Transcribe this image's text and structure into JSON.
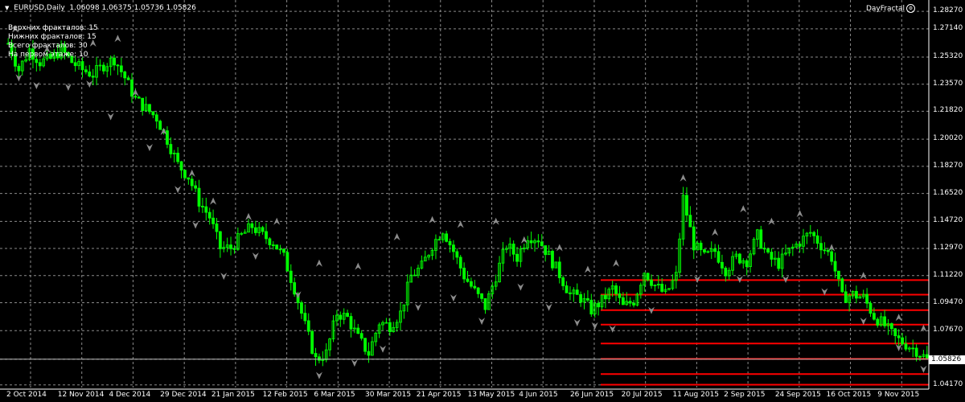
{
  "header": {
    "symbol": "EURUSD,Daily",
    "ohlc": "1.06098 1.06375 1.05736 1.05826",
    "indicator": "DayFractal"
  },
  "stats": [
    "Верхних фракталов: 15",
    "Нижних фракталов: 15",
    "Всего фракталов: 30",
    "На первом этаже: 10"
  ],
  "chart_data": {
    "type": "candlestick",
    "symbol": "EURUSD",
    "timeframe": "Daily",
    "current_price": "1.05826",
    "ylim": [
      1.04,
      1.29
    ],
    "y_ticks": [
      "1.28270",
      "1.27140",
      "1.25320",
      "1.23570",
      "1.21820",
      "1.20020",
      "1.18270",
      "1.16520",
      "1.14720",
      "1.12970",
      "1.11220",
      "1.09470",
      "1.07670",
      "1.05826",
      "1.04170"
    ],
    "x_ticks": [
      "2 Oct 2014",
      "12 Nov 2014",
      "4 Dec 2014",
      "29 Dec 2014",
      "21 Jan 2015",
      "12 Feb 2015",
      "6 Mar 2015",
      "30 Mar 2015",
      "21 Apr 2015",
      "13 May 2015",
      "4 Jun 2015",
      "26 Jun 2015",
      "20 Jul 2015",
      "11 Aug 2015",
      "2 Sep 2015",
      "24 Sep 2015",
      "16 Oct 2015",
      "9 Nov 2015"
    ],
    "price_path": [
      [
        0,
        1.262
      ],
      [
        3,
        1.245
      ],
      [
        6,
        1.258
      ],
      [
        9,
        1.25
      ],
      [
        12,
        1.252
      ],
      [
        15,
        1.258
      ],
      [
        18,
        1.25
      ],
      [
        21,
        1.245
      ],
      [
        24,
        1.242
      ],
      [
        27,
        1.248
      ],
      [
        30,
        1.252
      ],
      [
        33,
        1.24
      ],
      [
        36,
        1.226
      ],
      [
        39,
        1.22
      ],
      [
        42,
        1.214
      ],
      [
        45,
        1.2
      ],
      [
        48,
        1.184
      ],
      [
        51,
        1.176
      ],
      [
        54,
        1.16
      ],
      [
        57,
        1.15
      ],
      [
        60,
        1.13
      ],
      [
        63,
        1.13
      ],
      [
        66,
        1.138
      ],
      [
        69,
        1.144
      ],
      [
        72,
        1.138
      ],
      [
        75,
        1.134
      ],
      [
        78,
        1.124
      ],
      [
        81,
        1.104
      ],
      [
        84,
        1.08
      ],
      [
        87,
        1.058
      ],
      [
        90,
        1.062
      ],
      [
        93,
        1.088
      ],
      [
        96,
        1.085
      ],
      [
        99,
        1.072
      ],
      [
        102,
        1.062
      ],
      [
        105,
        1.082
      ],
      [
        108,
        1.08
      ],
      [
        111,
        1.088
      ],
      [
        114,
        1.112
      ],
      [
        117,
        1.118
      ],
      [
        120,
        1.132
      ],
      [
        123,
        1.142
      ],
      [
        126,
        1.128
      ],
      [
        129,
        1.112
      ],
      [
        132,
        1.102
      ],
      [
        135,
        1.092
      ],
      [
        138,
        1.112
      ],
      [
        141,
        1.132
      ],
      [
        144,
        1.124
      ],
      [
        147,
        1.138
      ],
      [
        150,
        1.136
      ],
      [
        153,
        1.125
      ],
      [
        156,
        1.113
      ],
      [
        159,
        1.1
      ],
      [
        162,
        1.098
      ],
      [
        165,
        1.09
      ],
      [
        168,
        1.096
      ],
      [
        171,
        1.104
      ],
      [
        174,
        1.092
      ],
      [
        177,
        1.096
      ],
      [
        180,
        1.115
      ],
      [
        183,
        1.106
      ],
      [
        186,
        1.1
      ],
      [
        189,
        1.112
      ],
      [
        191,
        1.162
      ],
      [
        194,
        1.132
      ],
      [
        197,
        1.124
      ],
      [
        200,
        1.128
      ],
      [
        203,
        1.116
      ],
      [
        206,
        1.124
      ],
      [
        209,
        1.122
      ],
      [
        212,
        1.138
      ],
      [
        215,
        1.124
      ],
      [
        218,
        1.12
      ],
      [
        221,
        1.128
      ],
      [
        224,
        1.134
      ],
      [
        227,
        1.14
      ],
      [
        230,
        1.132
      ],
      [
        233,
        1.124
      ],
      [
        236,
        1.098
      ],
      [
        239,
        1.1
      ],
      [
        242,
        1.098
      ],
      [
        245,
        1.086
      ],
      [
        248,
        1.08
      ],
      [
        251,
        1.072
      ],
      [
        254,
        1.068
      ],
      [
        257,
        1.064
      ],
      [
        260,
        1.058
      ]
    ],
    "fractals_up": [
      [
        2,
        1.271
      ],
      [
        11,
        1.258
      ],
      [
        24,
        1.262
      ],
      [
        31,
        1.265
      ],
      [
        36,
        1.23
      ],
      [
        44,
        1.205
      ],
      [
        52,
        1.178
      ],
      [
        58,
        1.16
      ],
      [
        68,
        1.15
      ],
      [
        76,
        1.147
      ],
      [
        88,
        1.12
      ],
      [
        99,
        1.118
      ],
      [
        110,
        1.137
      ],
      [
        120,
        1.148
      ],
      [
        128,
        1.145
      ],
      [
        138,
        1.147
      ],
      [
        146,
        1.135
      ],
      [
        156,
        1.13
      ],
      [
        164,
        1.116
      ],
      [
        172,
        1.12
      ],
      [
        191,
        1.175
      ],
      [
        200,
        1.14
      ],
      [
        208,
        1.155
      ],
      [
        216,
        1.147
      ],
      [
        224,
        1.152
      ],
      [
        233,
        1.13
      ],
      [
        242,
        1.112
      ],
      [
        252,
        1.085
      ],
      [
        259,
        1.078
      ]
    ],
    "fractals_down": [
      [
        3,
        1.24
      ],
      [
        8,
        1.235
      ],
      [
        17,
        1.234
      ],
      [
        23,
        1.236
      ],
      [
        29,
        1.215
      ],
      [
        40,
        1.195
      ],
      [
        48,
        1.168
      ],
      [
        53,
        1.145
      ],
      [
        61,
        1.112
      ],
      [
        70,
        1.125
      ],
      [
        82,
        1.1
      ],
      [
        88,
        1.048
      ],
      [
        98,
        1.056
      ],
      [
        106,
        1.065
      ],
      [
        116,
        1.092
      ],
      [
        126,
        1.098
      ],
      [
        134,
        1.083
      ],
      [
        145,
        1.105
      ],
      [
        153,
        1.092
      ],
      [
        161,
        1.082
      ],
      [
        166,
        1.08
      ],
      [
        171,
        1.078
      ],
      [
        182,
        1.09
      ],
      [
        195,
        1.11
      ],
      [
        207,
        1.11
      ],
      [
        220,
        1.11
      ],
      [
        231,
        1.102
      ],
      [
        242,
        1.083
      ],
      [
        252,
        1.066
      ],
      [
        259,
        1.052
      ]
    ],
    "levels": [
      1.1093,
      1.0999,
      1.0899,
      1.0806,
      1.0684,
      1.0585,
      1.0487,
      1.0418
    ],
    "grid": true,
    "colors": {
      "candles": "#00ff00",
      "background": "#000000",
      "grid": "#8a8a8a",
      "levels": "#ff0000",
      "fractals": "#8c8c8c",
      "text": "#ffffff"
    }
  }
}
